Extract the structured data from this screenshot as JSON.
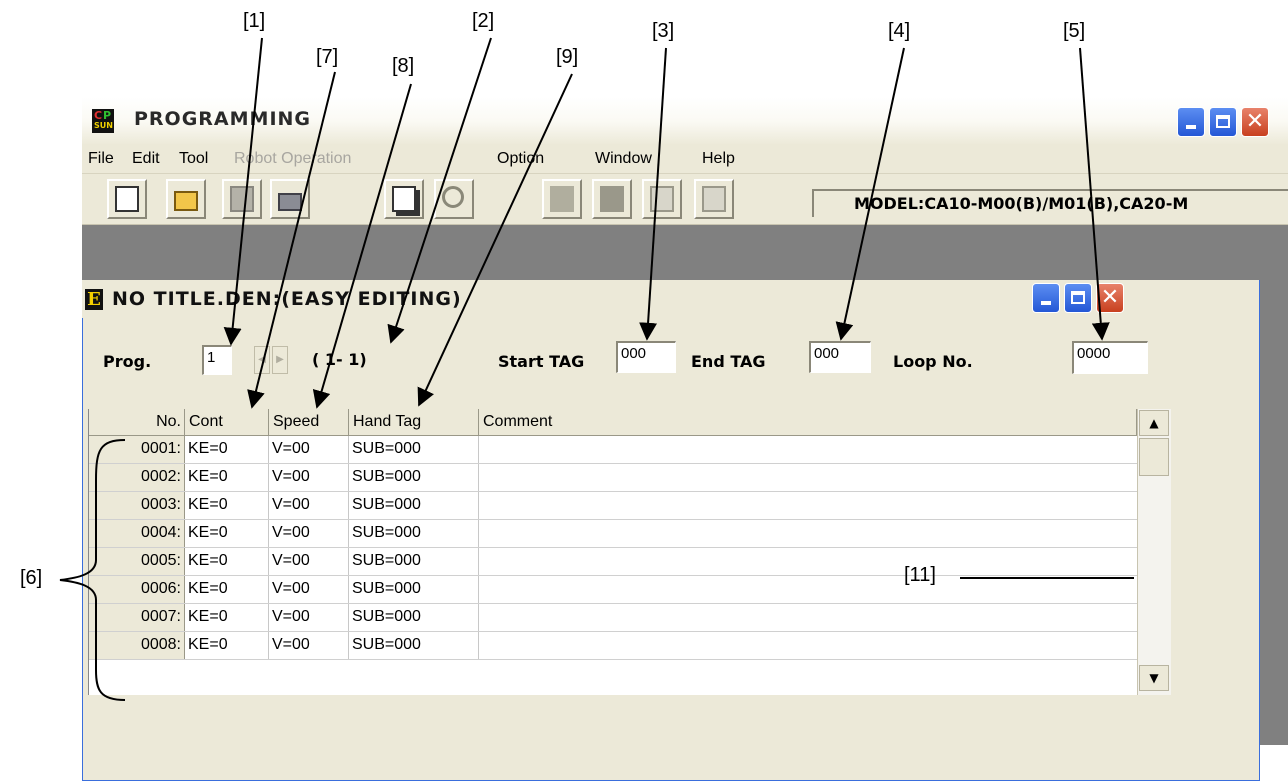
{
  "callouts": {
    "c1": "[1]",
    "c2": "[2]",
    "c3": "[3]",
    "c4": "[4]",
    "c5": "[5]",
    "c6": "[6]",
    "c7": "[7]",
    "c8": "[8]",
    "c9": "[9]",
    "c11": "[11]"
  },
  "window": {
    "title": "PROGRAMMING",
    "menu": [
      "File",
      "Edit",
      "Tool",
      "Robot Operation",
      "Option",
      "Window",
      "Help"
    ],
    "model": "MODEL:CA10-M00(B)/M01(B),CA20-M"
  },
  "child": {
    "title": "NO TITLE.DEN:(EASY EDITING)",
    "prog_label": "Prog.",
    "prog_value": "1",
    "range": "( 1- 1)",
    "start_tag_label": "Start TAG",
    "start_tag_value": "000",
    "end_tag_label": "End TAG",
    "end_tag_value": "000",
    "loop_label": "Loop No.",
    "loop_value": "0000"
  },
  "grid": {
    "headers": [
      "No.",
      "Cont",
      "Speed",
      "Hand Tag",
      "Comment"
    ],
    "rows": [
      {
        "no": "0001:",
        "cont": "KE=0",
        "speed": "V=00",
        "hand": "SUB=000",
        "comment": ""
      },
      {
        "no": "0002:",
        "cont": "KE=0",
        "speed": "V=00",
        "hand": "SUB=000",
        "comment": ""
      },
      {
        "no": "0003:",
        "cont": "KE=0",
        "speed": "V=00",
        "hand": "SUB=000",
        "comment": ""
      },
      {
        "no": "0004:",
        "cont": "KE=0",
        "speed": "V=00",
        "hand": "SUB=000",
        "comment": ""
      },
      {
        "no": "0005:",
        "cont": "KE=0",
        "speed": "V=00",
        "hand": "SUB=000",
        "comment": ""
      },
      {
        "no": "0006:",
        "cont": "KE=0",
        "speed": "V=00",
        "hand": "SUB=000",
        "comment": ""
      },
      {
        "no": "0007:",
        "cont": "KE=0",
        "speed": "V=00",
        "hand": "SUB=000",
        "comment": ""
      },
      {
        "no": "0008:",
        "cont": "KE=0",
        "speed": "V=00",
        "hand": "SUB=000",
        "comment": ""
      }
    ]
  },
  "icons": {
    "toolbar": [
      "new-file-icon",
      "open-folder-icon",
      "save-icon",
      "print-icon",
      "copy-pages-icon",
      "find-icon",
      "robot-icon",
      "transfer-icon",
      "upload-icon",
      "download-icon"
    ]
  }
}
